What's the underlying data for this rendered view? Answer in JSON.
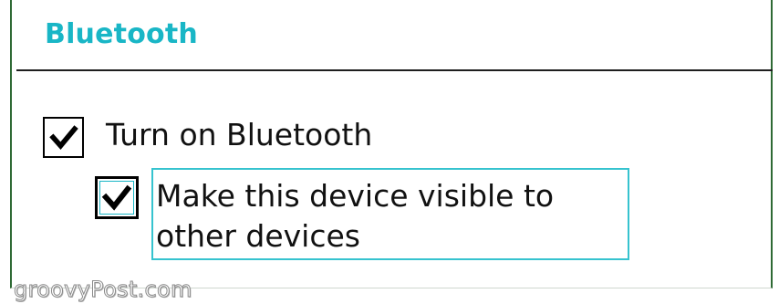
{
  "section": {
    "title": "Bluetooth"
  },
  "options": {
    "turn_on_bluetooth": {
      "label": "Turn on Bluetooth",
      "checked": true
    },
    "visible_to_other_devices": {
      "label": "Make this device visible to other devices",
      "checked": true,
      "focused": true
    }
  },
  "watermark": {
    "text": "groovyPost.com"
  },
  "colors": {
    "title": "#19b6c6",
    "focus_outline": "#36c3cf",
    "frame_border": "#2f6a35",
    "text": "#111111"
  },
  "icons": {
    "checkmark": "checkmark-icon"
  }
}
